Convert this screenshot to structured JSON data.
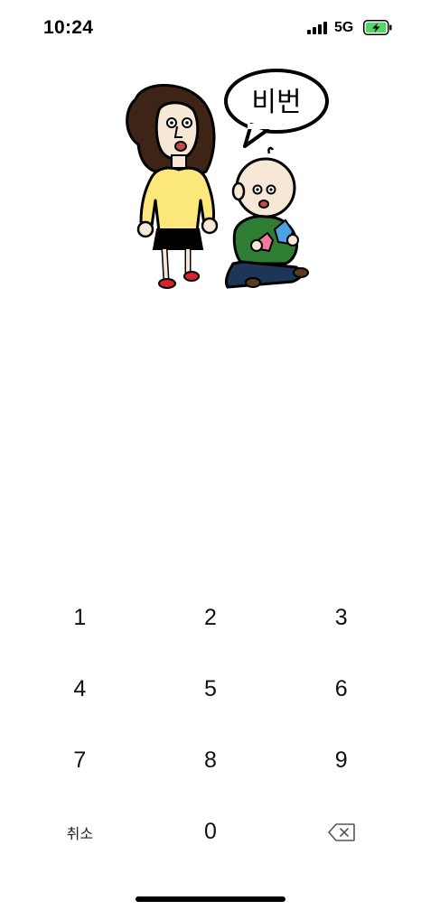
{
  "status_bar": {
    "time": "10:24",
    "network": "5G",
    "signal_icon": "cellular-signal-icon",
    "battery_icon": "battery-charging-icon",
    "battery_color": "#4cd964"
  },
  "illustration": {
    "bubble_text": "비번",
    "skin_color": "#f6e7d6",
    "hair_color": "#3e2416",
    "woman_shirt_color": "#fbe77a",
    "skirt_color": "#000000",
    "shoe_color": "#d8232a",
    "child_shirt_color": "#2e7d32",
    "child_pants_color": "#1d3557"
  },
  "keypad": {
    "keys": [
      "1",
      "2",
      "3",
      "4",
      "5",
      "6",
      "7",
      "8",
      "9"
    ],
    "cancel_label": "취소",
    "zero": "0",
    "delete_icon": "backspace-icon"
  }
}
